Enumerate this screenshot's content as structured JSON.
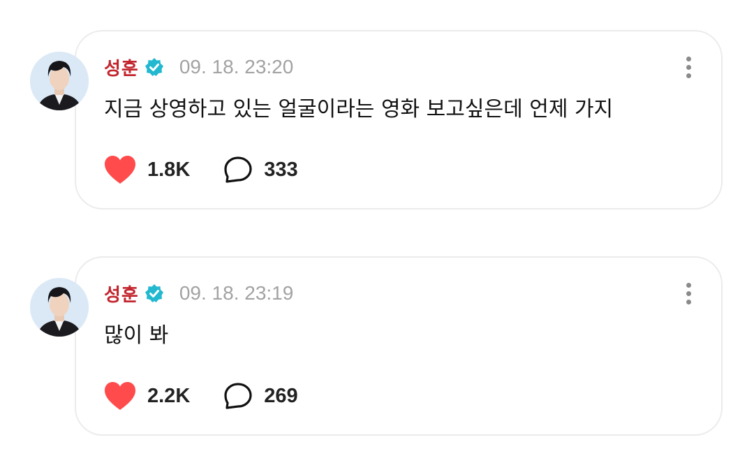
{
  "posts": [
    {
      "author": "성훈",
      "timestamp": "09. 18. 23:20",
      "text": "지금 상영하고 있는 얼굴이라는 영화 보고싶은데 언제 가지",
      "likes": "1.8K",
      "comments": "333"
    },
    {
      "author": "성훈",
      "timestamp": "09. 18. 23:19",
      "text": "많이 봐",
      "likes": "2.2K",
      "comments": "269"
    }
  ],
  "icons": {
    "verified": "verified-badge-icon",
    "like": "heart-icon",
    "comment": "comment-bubble-icon",
    "more": "more-vertical-icon"
  },
  "colors": {
    "author_name": "#c2262e",
    "verified_badge": "#22b8cf",
    "heart": "#ff4b4b",
    "timestamp": "#a2a2a2",
    "card_border": "#ebebeb"
  }
}
